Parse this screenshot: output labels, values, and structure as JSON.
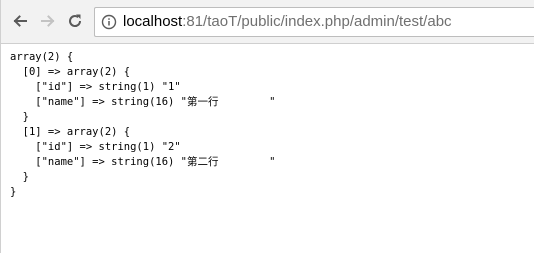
{
  "toolbar": {
    "back_icon": "arrow-left-icon",
    "forward_icon": "arrow-right-icon",
    "reload_icon": "reload-icon",
    "info_icon": "info-circle-icon",
    "url_host": "localhost",
    "url_rest": ":81/taoT/public/index.php/admin/test/abc"
  },
  "dump": {
    "lines": [
      "array(2) {",
      "  [0] => array(2) {",
      "    [\"id\"] => string(1) \"1\"",
      "    [\"name\"] => string(16) \"第一行        \"",
      "  }",
      "  [1] => array(2) {",
      "    [\"id\"] => string(1) \"2\"",
      "    [\"name\"] => string(16) \"第二行        \"",
      "  }",
      "}"
    ]
  }
}
